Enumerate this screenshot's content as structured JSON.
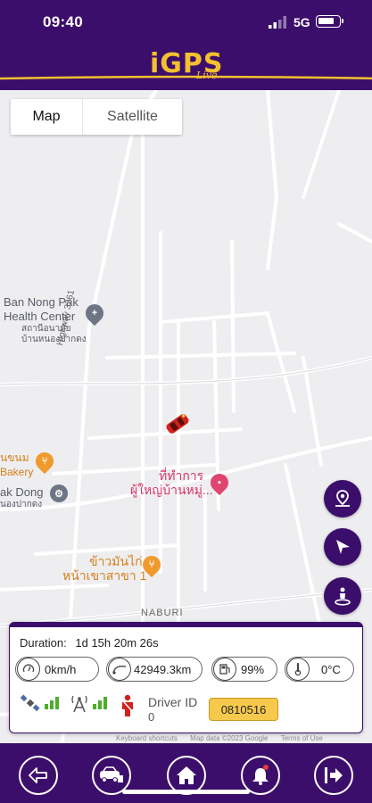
{
  "status_bar": {
    "time": "09:40",
    "network": "5G"
  },
  "app": {
    "logo_main": "iGPS",
    "logo_sub": "Live"
  },
  "map": {
    "type_control": {
      "map_label": "Map",
      "satellite_label": "Satellite",
      "selected": "Map"
    },
    "pois": [
      {
        "name_en": "Ban Nong Pak",
        "name_en2": "Health Center",
        "name_th": "สถานีอนามัย",
        "name_th2": "บ้านหนองปากดง"
      },
      {
        "name_th": "นขนม",
        "name_en": "Bakery"
      },
      {
        "name_en": "ak Dong",
        "name_th": "นองปากดง"
      },
      {
        "name_th": "ที่ทำการ",
        "name_th2": "ผู้ใหญ่บ้านหมู่..."
      },
      {
        "name_th": "ข้าวมันไก่",
        "name_th2": "หน้าเขาสาขา 1"
      }
    ],
    "road_labels": [
      "Highway 3261",
      "NABURI"
    ],
    "attribution": {
      "shortcuts": "Keyboard shortcuts",
      "data": "Map data ©2023 Google",
      "terms": "Terms of Use"
    }
  },
  "info": {
    "duration_label": "Duration:",
    "duration_value": "1d 15h 20m 26s",
    "speed": "0km/h",
    "odometer": "42949.3km",
    "fuel": "99%",
    "temperature": "0°C",
    "driver_label": "Driver ID",
    "driver_value": "0",
    "driver_id": "0810516"
  },
  "icons": {
    "gps_signal": "satellite-icon",
    "gsm_signal": "antenna-icon",
    "driver": "seatbelt-icon",
    "nav": [
      "back-icon",
      "vehicle-list-icon",
      "home-icon",
      "notification-bell-icon",
      "logout-icon"
    ]
  },
  "colors": {
    "primary": "#3c0e6b",
    "accent": "#f3c02e",
    "driver_id_bg": "#f6c94c",
    "signal_green": "#4caf2a",
    "car_red": "#d0211b"
  }
}
